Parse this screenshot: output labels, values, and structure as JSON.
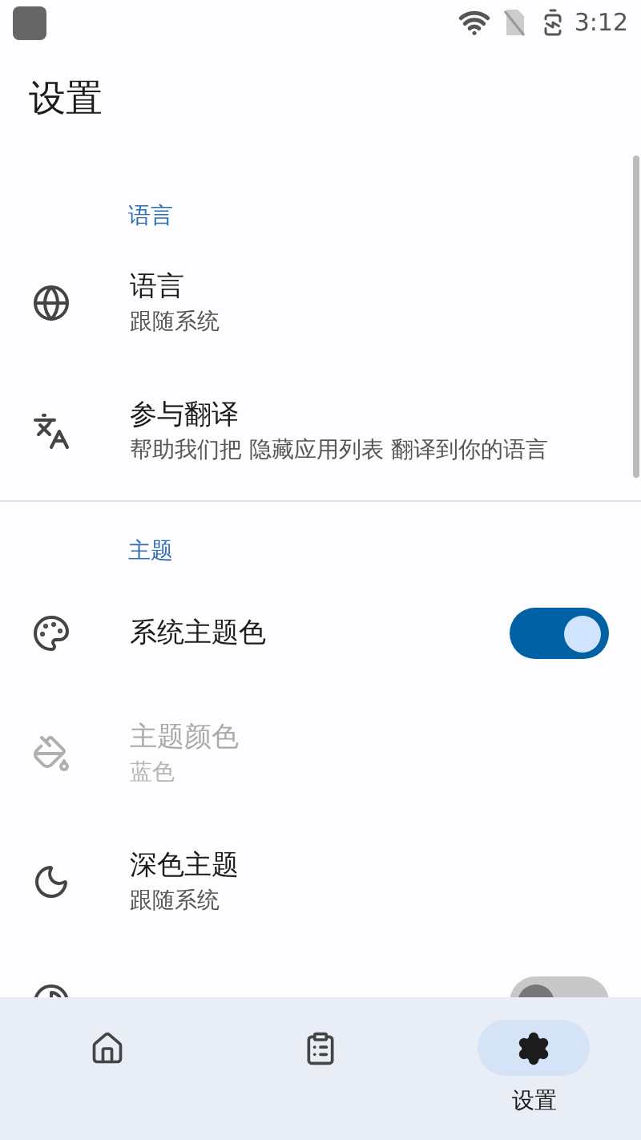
{
  "status_bar": {
    "time": "3:12"
  },
  "title": "设置",
  "sections": [
    {
      "header": "语言",
      "items": [
        {
          "kind": "link",
          "title": "语言",
          "subtitle": "跟随系统",
          "disabled": false
        },
        {
          "kind": "link",
          "title": "参与翻译",
          "subtitle": "帮助我们把 隐藏应用列表 翻译到你的语言",
          "disabled": false
        }
      ]
    },
    {
      "header": "主题",
      "items": [
        {
          "kind": "switch",
          "title": "系统主题色",
          "on": true,
          "disabled": false
        },
        {
          "kind": "link",
          "title": "主题颜色",
          "subtitle": "蓝色",
          "disabled": true
        },
        {
          "kind": "link",
          "title": "深色主题",
          "subtitle": "跟随系统",
          "disabled": false
        },
        {
          "kind": "switch",
          "on": false,
          "disabled": false
        }
      ]
    }
  ],
  "nav": [
    {
      "selected": false
    },
    {
      "selected": false
    },
    {
      "label": "设置",
      "selected": true
    }
  ]
}
